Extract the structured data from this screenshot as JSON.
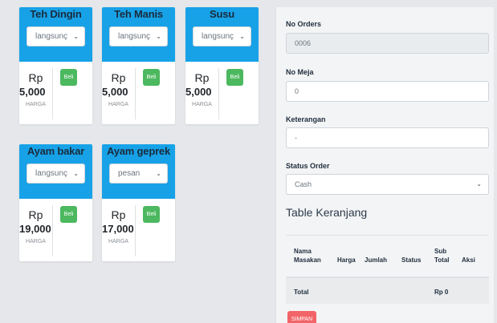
{
  "products": [
    {
      "name": "Teh Dingin",
      "option": "langsunç",
      "rp": "Rp",
      "price": "5,000",
      "harga": "HARGA",
      "beli": "Beli"
    },
    {
      "name": "Teh Manis",
      "option": "langsunç",
      "rp": "Rp",
      "price": "5,000",
      "harga": "HARGA",
      "beli": "Beli"
    },
    {
      "name": "Susu",
      "option": "langsunç",
      "rp": "Rp",
      "price": "5,000",
      "harga": "HARGA",
      "beli": "Beli"
    },
    {
      "name": "Ayam bakar",
      "option": "langsunç",
      "rp": "Rp",
      "price": "19,000",
      "harga": "HARGA",
      "beli": "Beli"
    },
    {
      "name": "Ayam geprek",
      "option": "pesan",
      "rp": "Rp",
      "price": "17,000",
      "harga": "HARGA",
      "beli": "Beli"
    }
  ],
  "form": {
    "no_orders_label": "No Orders",
    "no_orders_value": "0006",
    "no_meja_label": "No Meja",
    "no_meja_value": "0",
    "keterangan_label": "Keterangan",
    "keterangan_value": "-",
    "status_label": "Status Order",
    "status_value": "Cash"
  },
  "cart": {
    "title": "Table Keranjang",
    "headers": {
      "nama_1": "Nama",
      "nama_2": "Masakan",
      "harga": "Harga",
      "jumlah": "Jumlah",
      "status": "Status",
      "sub_1": "Sub",
      "sub_2": "Total",
      "aksi": "Aksi"
    },
    "total_label": "Total",
    "total_value": "Rp 0"
  },
  "actions": {
    "simpan": "SIMPAN"
  },
  "colors": {
    "card_header": "#17a2e8",
    "beli_button": "#4cb85f",
    "simpan_button": "#f16468"
  }
}
